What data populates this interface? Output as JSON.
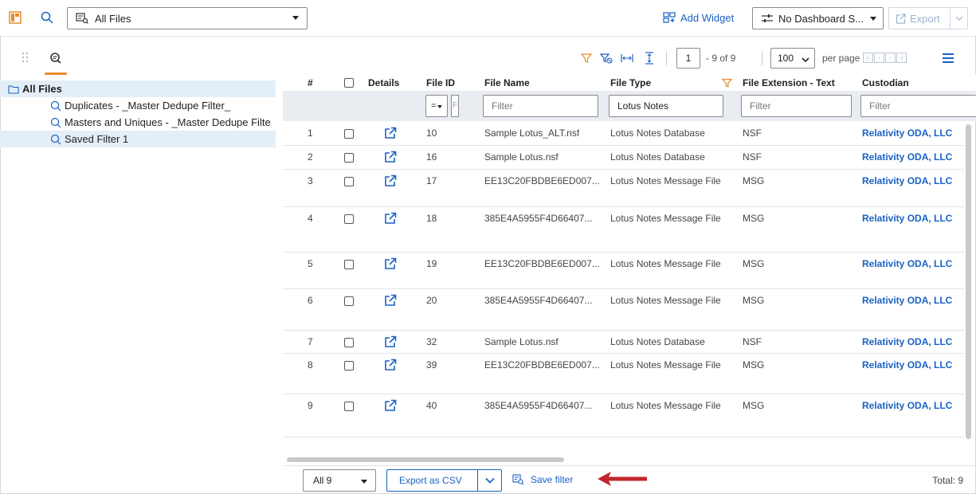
{
  "topbar": {
    "view_select": "All Files",
    "add_widget": "Add Widget",
    "dashboard_select": "No Dashboard S...",
    "export": "Export"
  },
  "left_panel": {
    "tree": [
      {
        "label": "All Files",
        "type": "folder"
      },
      {
        "label": "Duplicates - _Master Dedupe Filter_",
        "type": "search"
      },
      {
        "label": "Masters and Uniques - _Master Dedupe Filte",
        "type": "search"
      },
      {
        "label": "Saved Filter 1",
        "type": "search",
        "selected": true
      }
    ]
  },
  "grid": {
    "paging": {
      "page": "1",
      "of_text": "- 9 of 9",
      "per_page_value": "100",
      "per_page_label": "per page"
    },
    "columns": {
      "num": "#",
      "details": "Details",
      "file_id": "File ID",
      "file_name": "File Name",
      "file_type": "File Type",
      "file_ext": "File Extension - Text",
      "custodian": "Custodian"
    },
    "filters": {
      "file_id_op": "=",
      "file_id_partial": "F",
      "file_name": "Filter",
      "file_type": "Lotus Notes",
      "file_ext": "Filter",
      "custodian": "Filter"
    },
    "rows": [
      {
        "num": "1",
        "file_id": "10",
        "file_name": "Sample Lotus_ALT.nsf",
        "file_type": "Lotus Notes Database",
        "file_ext": "NSF",
        "custodian": "Relativity ODA, LLC"
      },
      {
        "num": "2",
        "file_id": "16",
        "file_name": "Sample Lotus.nsf",
        "file_type": "Lotus Notes Database",
        "file_ext": "NSF",
        "custodian": "Relativity ODA, LLC"
      },
      {
        "num": "3",
        "file_id": "17",
        "file_name": "EE13C20FBDBE6ED007...",
        "file_type": "Lotus Notes Message File",
        "file_ext": "MSG",
        "custodian": "Relativity ODA, LLC"
      },
      {
        "num": "4",
        "file_id": "18",
        "file_name": "385E4A5955F4D66407...",
        "file_type": "Lotus Notes Message File",
        "file_ext": "MSG",
        "custodian": "Relativity ODA, LLC"
      },
      {
        "num": "5",
        "file_id": "19",
        "file_name": "EE13C20FBDBE6ED007...",
        "file_type": "Lotus Notes Message File",
        "file_ext": "MSG",
        "custodian": "Relativity ODA, LLC"
      },
      {
        "num": "6",
        "file_id": "20",
        "file_name": "385E4A5955F4D66407...",
        "file_type": "Lotus Notes Message File",
        "file_ext": "MSG",
        "custodian": "Relativity ODA, LLC"
      },
      {
        "num": "7",
        "file_id": "32",
        "file_name": "Sample Lotus.nsf",
        "file_type": "Lotus Notes Database",
        "file_ext": "NSF",
        "custodian": "Relativity ODA, LLC"
      },
      {
        "num": "8",
        "file_id": "39",
        "file_name": "EE13C20FBDBE6ED007...",
        "file_type": "Lotus Notes Message File",
        "file_ext": "MSG",
        "custodian": "Relativity ODA, LLC"
      },
      {
        "num": "9",
        "file_id": "40",
        "file_name": "385E4A5955F4D66407...",
        "file_type": "Lotus Notes Message File",
        "file_ext": "MSG",
        "custodian": "Relativity ODA, LLC"
      }
    ],
    "footer": {
      "scope_select": "All 9",
      "export_csv": "Export as CSV",
      "save_filter": "Save filter",
      "total": "Total: 9"
    }
  },
  "colors": {
    "accent": "#1a62c4",
    "orange": "#e98c2a",
    "selected_bg": "#e3eef7",
    "filter_row_bg": "#e9edf2",
    "arrow": "#c0262c"
  },
  "icons": [
    "dashboard-icon",
    "search-icon",
    "saved-search-icon",
    "add-widget-icon",
    "sliders-icon",
    "export-icon",
    "folder-icon",
    "filter-icon",
    "clear-filter-icon",
    "fit-width-icon",
    "fit-height-icon",
    "menu-icon",
    "open-record-icon",
    "save-filter-icon"
  ]
}
